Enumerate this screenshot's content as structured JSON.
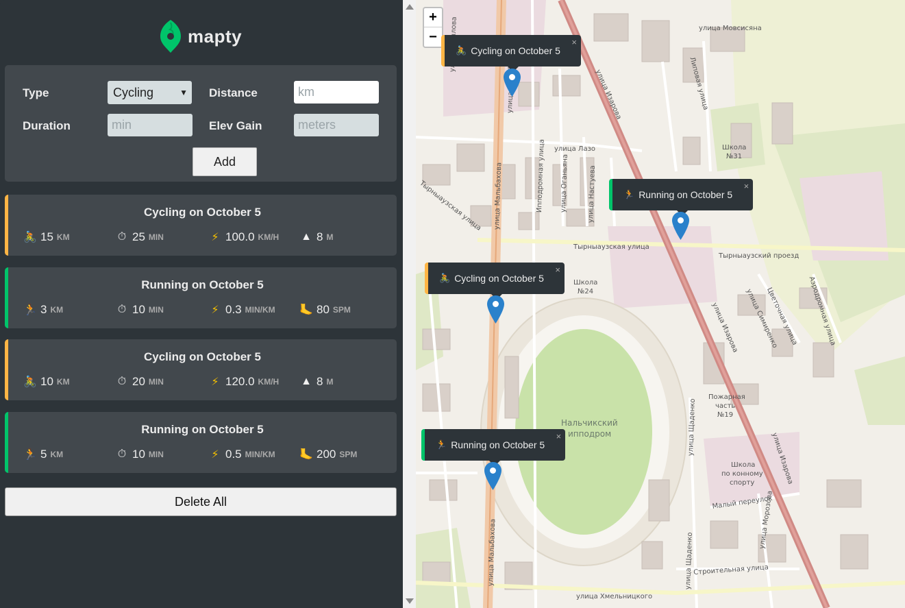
{
  "app": {
    "name": "mapty",
    "accent": "#00c46a",
    "cycling_color": "#ffb545",
    "running_color": "#00c46a"
  },
  "form": {
    "type_label": "Type",
    "type_value": "Cycling",
    "distance_label": "Distance",
    "distance_placeholder": "km",
    "duration_label": "Duration",
    "duration_placeholder": "min",
    "elev_label": "Elev Gain",
    "elev_placeholder": "meters",
    "add_label": "Add"
  },
  "workouts": [
    {
      "type": "cycling",
      "title": "Cycling on October 5",
      "distance": "15",
      "distance_unit": "KM",
      "duration": "25",
      "duration_unit": "MIN",
      "speed": "100.0",
      "speed_unit": "KM/H",
      "extra": "8",
      "extra_unit": "M"
    },
    {
      "type": "running",
      "title": "Running on October 5",
      "distance": "3",
      "distance_unit": "KM",
      "duration": "10",
      "duration_unit": "MIN",
      "speed": "0.3",
      "speed_unit": "MIN/KM",
      "extra": "80",
      "extra_unit": "SPM"
    },
    {
      "type": "cycling",
      "title": "Cycling on October 5",
      "distance": "10",
      "distance_unit": "KM",
      "duration": "20",
      "duration_unit": "MIN",
      "speed": "120.0",
      "speed_unit": "KM/H",
      "extra": "8",
      "extra_unit": "M"
    },
    {
      "type": "running",
      "title": "Running on October 5",
      "distance": "5",
      "distance_unit": "KM",
      "duration": "10",
      "duration_unit": "MIN",
      "speed": "0.5",
      "speed_unit": "MIN/KM",
      "extra": "200",
      "extra_unit": "SPM"
    }
  ],
  "delete_all_label": "Delete All",
  "map": {
    "zoom_in": "+",
    "zoom_out": "−",
    "popups": [
      {
        "type": "cycling",
        "text": "Cycling on October 5",
        "close": "×"
      },
      {
        "type": "running",
        "text": "Running on October 5",
        "close": "×"
      },
      {
        "type": "cycling",
        "text": "Cycling on October 5",
        "close": "×"
      },
      {
        "type": "running",
        "text": "Running on October 5",
        "close": "×"
      }
    ],
    "labels": {
      "movsisyan": "улица Мовсисяна",
      "lipovaya": "Липовая улица",
      "krylova": "улица Крылова",
      "malbakhova_top": "улица Мальбахова",
      "izarova_top": "улица Изарова",
      "lazo": "улица Лазо",
      "school31_a": "Школа",
      "school31_b": "№31",
      "tyrnyauzskaya_left": "Тырныаузская улица",
      "malbakhova_mid": "улица Мальбахова",
      "ippodromnaya": "Ипподромная улица",
      "oganyan": "улица Оганьяна",
      "nastueva": "улица Настуева",
      "tyrnyauzskaya_mid": "Тырныаузская улица",
      "tyrnyauzsky_proezd": "Тырныаузский проезд",
      "school24_a": "Школа",
      "school24_b": "№24",
      "tsvetochnaya": "Цветочная улица",
      "simirenko": "улица Симиренко",
      "aerodromnaya": "Аэродромная улица",
      "izarova_mid": "улица Изарова",
      "ippodrom_a": "Нальчикский",
      "ippodrom_b": "ипподром",
      "fire_a": "Пожарная",
      "fire_b": "часть",
      "fire_c": "№19",
      "shchadenko_mid": "улица Щаденко",
      "school_konny_a": "Школа",
      "school_konny_b": "по конному",
      "school_konny_c": "спорту",
      "maly_pereulok": "Малый переулок",
      "morozova": "улица Морозова",
      "stroitelnaya": "Строительная улица",
      "khmelnitskogo": "улица Хмельницкого",
      "malbakhova_bot": "улица Мальбахова",
      "izarova_bot": "улица Изарова",
      "shchadenko_bot": "улица Щаденко"
    }
  }
}
